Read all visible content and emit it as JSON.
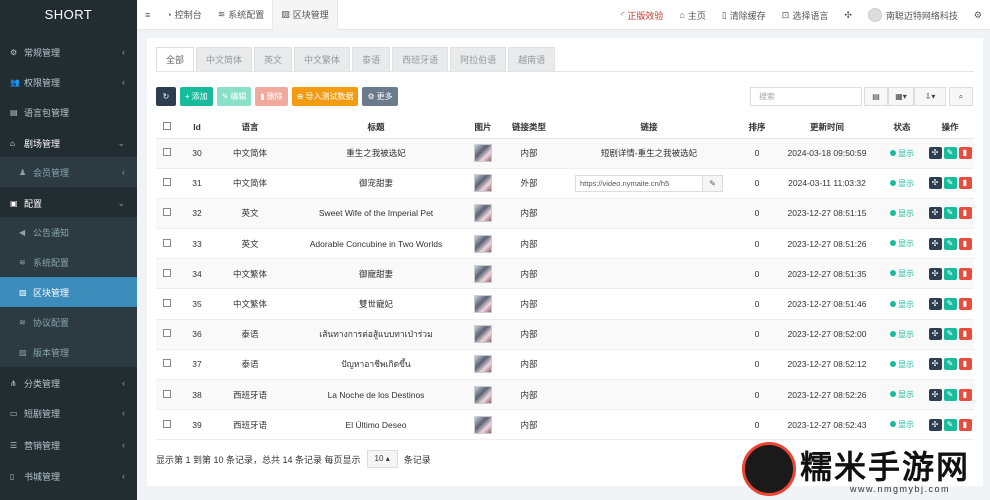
{
  "app": {
    "logo": "SHORT"
  },
  "sidebar": {
    "items": [
      {
        "label": "常规管理",
        "icon": "cogs-icon",
        "glyph": "⚙",
        "chev": "‹"
      },
      {
        "label": "权限管理",
        "icon": "group-icon",
        "glyph": "👥",
        "chev": "‹"
      },
      {
        "label": "语言包管理",
        "icon": "file-icon",
        "glyph": "▤",
        "chev": ""
      },
      {
        "label": "剧场管理",
        "icon": "home-icon",
        "glyph": "⌂",
        "chev": "⌄"
      },
      {
        "label": "会员管理",
        "icon": "user-icon",
        "glyph": "♟",
        "chev": "‹"
      },
      {
        "label": "配置",
        "icon": "file-icon",
        "glyph": "▣",
        "chev": "⌄"
      },
      {
        "label": "公告通知",
        "icon": "bullhorn-icon",
        "glyph": "◀",
        "chev": ""
      },
      {
        "label": "系统配置",
        "icon": "sliders-icon",
        "glyph": "≋",
        "chev": ""
      },
      {
        "label": "区块管理",
        "icon": "image-icon",
        "glyph": "▨",
        "chev": ""
      },
      {
        "label": "协议配置",
        "icon": "sliders-icon",
        "glyph": "≋",
        "chev": ""
      },
      {
        "label": "版本管理",
        "icon": "image-icon",
        "glyph": "▨",
        "chev": ""
      },
      {
        "label": "分类管理",
        "icon": "sitemap-icon",
        "glyph": "⋔",
        "chev": "‹"
      },
      {
        "label": "短剧管理",
        "icon": "film-icon",
        "glyph": "▭",
        "chev": "‹"
      },
      {
        "label": "营销管理",
        "icon": "shopping-icon",
        "glyph": "☰",
        "chev": "‹"
      },
      {
        "label": "书城管理",
        "icon": "book-icon",
        "glyph": "▯",
        "chev": "‹"
      }
    ]
  },
  "topbar": {
    "menu_glyph": "≡",
    "dashboard": "控制台",
    "sysconfig": "系统配置",
    "blocks": "区块管理",
    "genuine": "正版效验",
    "home": "主页",
    "clear_cache": "清除缓存",
    "lang": "选择语言",
    "username": "南聪迈特网络科技"
  },
  "tabs": [
    "全部",
    "中文简体",
    "英文",
    "中文繁体",
    "泰语",
    "西班牙语",
    "阿拉伯语",
    "越南语"
  ],
  "toolbar": {
    "add": "添加",
    "edit": "编辑",
    "delete": "删除",
    "import": "导入测试数据",
    "more": "更多",
    "search_placeholder": "搜索"
  },
  "table": {
    "headers": [
      "",
      "Id",
      "语言",
      "标题",
      "图片",
      "链接类型",
      "链接",
      "排序",
      "更新时间",
      "状态",
      "操作"
    ],
    "rows": [
      {
        "id": "30",
        "lang": "中文简体",
        "title": "重生之我被选妃",
        "link_type": "内部",
        "link": "短剧详情-重生之我被选妃",
        "link_is_url": false,
        "sort": "0",
        "updated": "2024-03-18 09:50:59",
        "status": "显示"
      },
      {
        "id": "31",
        "lang": "中文简体",
        "title": "御宠甜妻",
        "link_type": "外部",
        "link": "https://video.nymaite.cn/h5",
        "link_is_url": true,
        "sort": "0",
        "updated": "2024-03-11 11:03:32",
        "status": "显示"
      },
      {
        "id": "32",
        "lang": "英文",
        "title": "Sweet Wife of the Imperial Pet",
        "link_type": "内部",
        "link": "",
        "link_is_url": false,
        "sort": "0",
        "updated": "2023-12-27 08:51:15",
        "status": "显示"
      },
      {
        "id": "33",
        "lang": "英文",
        "title": "Adorable Concubine in Two Worlds",
        "link_type": "内部",
        "link": "",
        "link_is_url": false,
        "sort": "0",
        "updated": "2023-12-27 08:51:26",
        "status": "显示"
      },
      {
        "id": "34",
        "lang": "中文繁体",
        "title": "御寵甜妻",
        "link_type": "内部",
        "link": "",
        "link_is_url": false,
        "sort": "0",
        "updated": "2023-12-27 08:51:35",
        "status": "显示"
      },
      {
        "id": "35",
        "lang": "中文繁体",
        "title": "雙世寵妃",
        "link_type": "内部",
        "link": "",
        "link_is_url": false,
        "sort": "0",
        "updated": "2023-12-27 08:51:46",
        "status": "显示"
      },
      {
        "id": "36",
        "lang": "泰语",
        "title": "เส้นทางการต่อสู้แบบทาเป่าร่วม",
        "link_type": "内部",
        "link": "",
        "link_is_url": false,
        "sort": "0",
        "updated": "2023-12-27 08:52:00",
        "status": "显示"
      },
      {
        "id": "37",
        "lang": "泰语",
        "title": "ปัญหาอาชีพเกิดขึ้น",
        "link_type": "内部",
        "link": "",
        "link_is_url": false,
        "sort": "0",
        "updated": "2023-12-27 08:52:12",
        "status": "显示"
      },
      {
        "id": "38",
        "lang": "西班牙语",
        "title": "La Noche de los Destinos",
        "link_type": "内部",
        "link": "",
        "link_is_url": false,
        "sort": "0",
        "updated": "2023-12-27 08:52:26",
        "status": "显示"
      },
      {
        "id": "39",
        "lang": "西班牙语",
        "title": "El Último Deseo",
        "link_type": "内部",
        "link": "",
        "link_is_url": false,
        "sort": "0",
        "updated": "2023-12-27 08:52:43",
        "status": "显示"
      }
    ]
  },
  "footer": {
    "summary": "显示第 1 到第 10 条记录，总共 14 条记录 每页显示",
    "page_size": "10",
    "suffix": "条记录"
  },
  "watermark": {
    "text": "糯米手游网",
    "url": "www.nmgmybj.com"
  }
}
